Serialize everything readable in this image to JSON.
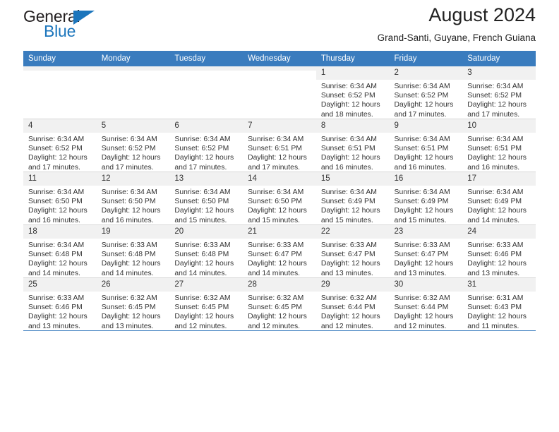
{
  "brand": {
    "name_part1": "General",
    "name_part2": "Blue",
    "triangle_color": "#1b75bc"
  },
  "header": {
    "title": "August 2024",
    "subtitle": "Grand-Santi, Guyane, French Guiana",
    "header_bg": "#3a7cbe"
  },
  "weekday_headers": [
    "Sunday",
    "Monday",
    "Tuesday",
    "Wednesday",
    "Thursday",
    "Friday",
    "Saturday"
  ],
  "weeks": [
    [
      {
        "day": "",
        "empty": true
      },
      {
        "day": "",
        "empty": true
      },
      {
        "day": "",
        "empty": true
      },
      {
        "day": "",
        "empty": true
      },
      {
        "day": "1",
        "sunrise": "Sunrise: 6:34 AM",
        "sunset": "Sunset: 6:52 PM",
        "daylight1": "Daylight: 12 hours",
        "daylight2": "and 18 minutes."
      },
      {
        "day": "2",
        "sunrise": "Sunrise: 6:34 AM",
        "sunset": "Sunset: 6:52 PM",
        "daylight1": "Daylight: 12 hours",
        "daylight2": "and 17 minutes."
      },
      {
        "day": "3",
        "sunrise": "Sunrise: 6:34 AM",
        "sunset": "Sunset: 6:52 PM",
        "daylight1": "Daylight: 12 hours",
        "daylight2": "and 17 minutes."
      }
    ],
    [
      {
        "day": "4",
        "sunrise": "Sunrise: 6:34 AM",
        "sunset": "Sunset: 6:52 PM",
        "daylight1": "Daylight: 12 hours",
        "daylight2": "and 17 minutes."
      },
      {
        "day": "5",
        "sunrise": "Sunrise: 6:34 AM",
        "sunset": "Sunset: 6:52 PM",
        "daylight1": "Daylight: 12 hours",
        "daylight2": "and 17 minutes."
      },
      {
        "day": "6",
        "sunrise": "Sunrise: 6:34 AM",
        "sunset": "Sunset: 6:52 PM",
        "daylight1": "Daylight: 12 hours",
        "daylight2": "and 17 minutes."
      },
      {
        "day": "7",
        "sunrise": "Sunrise: 6:34 AM",
        "sunset": "Sunset: 6:51 PM",
        "daylight1": "Daylight: 12 hours",
        "daylight2": "and 17 minutes."
      },
      {
        "day": "8",
        "sunrise": "Sunrise: 6:34 AM",
        "sunset": "Sunset: 6:51 PM",
        "daylight1": "Daylight: 12 hours",
        "daylight2": "and 16 minutes."
      },
      {
        "day": "9",
        "sunrise": "Sunrise: 6:34 AM",
        "sunset": "Sunset: 6:51 PM",
        "daylight1": "Daylight: 12 hours",
        "daylight2": "and 16 minutes."
      },
      {
        "day": "10",
        "sunrise": "Sunrise: 6:34 AM",
        "sunset": "Sunset: 6:51 PM",
        "daylight1": "Daylight: 12 hours",
        "daylight2": "and 16 minutes."
      }
    ],
    [
      {
        "day": "11",
        "sunrise": "Sunrise: 6:34 AM",
        "sunset": "Sunset: 6:50 PM",
        "daylight1": "Daylight: 12 hours",
        "daylight2": "and 16 minutes."
      },
      {
        "day": "12",
        "sunrise": "Sunrise: 6:34 AM",
        "sunset": "Sunset: 6:50 PM",
        "daylight1": "Daylight: 12 hours",
        "daylight2": "and 16 minutes."
      },
      {
        "day": "13",
        "sunrise": "Sunrise: 6:34 AM",
        "sunset": "Sunset: 6:50 PM",
        "daylight1": "Daylight: 12 hours",
        "daylight2": "and 15 minutes."
      },
      {
        "day": "14",
        "sunrise": "Sunrise: 6:34 AM",
        "sunset": "Sunset: 6:50 PM",
        "daylight1": "Daylight: 12 hours",
        "daylight2": "and 15 minutes."
      },
      {
        "day": "15",
        "sunrise": "Sunrise: 6:34 AM",
        "sunset": "Sunset: 6:49 PM",
        "daylight1": "Daylight: 12 hours",
        "daylight2": "and 15 minutes."
      },
      {
        "day": "16",
        "sunrise": "Sunrise: 6:34 AM",
        "sunset": "Sunset: 6:49 PM",
        "daylight1": "Daylight: 12 hours",
        "daylight2": "and 15 minutes."
      },
      {
        "day": "17",
        "sunrise": "Sunrise: 6:34 AM",
        "sunset": "Sunset: 6:49 PM",
        "daylight1": "Daylight: 12 hours",
        "daylight2": "and 14 minutes."
      }
    ],
    [
      {
        "day": "18",
        "sunrise": "Sunrise: 6:34 AM",
        "sunset": "Sunset: 6:48 PM",
        "daylight1": "Daylight: 12 hours",
        "daylight2": "and 14 minutes."
      },
      {
        "day": "19",
        "sunrise": "Sunrise: 6:33 AM",
        "sunset": "Sunset: 6:48 PM",
        "daylight1": "Daylight: 12 hours",
        "daylight2": "and 14 minutes."
      },
      {
        "day": "20",
        "sunrise": "Sunrise: 6:33 AM",
        "sunset": "Sunset: 6:48 PM",
        "daylight1": "Daylight: 12 hours",
        "daylight2": "and 14 minutes."
      },
      {
        "day": "21",
        "sunrise": "Sunrise: 6:33 AM",
        "sunset": "Sunset: 6:47 PM",
        "daylight1": "Daylight: 12 hours",
        "daylight2": "and 14 minutes."
      },
      {
        "day": "22",
        "sunrise": "Sunrise: 6:33 AM",
        "sunset": "Sunset: 6:47 PM",
        "daylight1": "Daylight: 12 hours",
        "daylight2": "and 13 minutes."
      },
      {
        "day": "23",
        "sunrise": "Sunrise: 6:33 AM",
        "sunset": "Sunset: 6:47 PM",
        "daylight1": "Daylight: 12 hours",
        "daylight2": "and 13 minutes."
      },
      {
        "day": "24",
        "sunrise": "Sunrise: 6:33 AM",
        "sunset": "Sunset: 6:46 PM",
        "daylight1": "Daylight: 12 hours",
        "daylight2": "and 13 minutes."
      }
    ],
    [
      {
        "day": "25",
        "sunrise": "Sunrise: 6:33 AM",
        "sunset": "Sunset: 6:46 PM",
        "daylight1": "Daylight: 12 hours",
        "daylight2": "and 13 minutes."
      },
      {
        "day": "26",
        "sunrise": "Sunrise: 6:32 AM",
        "sunset": "Sunset: 6:45 PM",
        "daylight1": "Daylight: 12 hours",
        "daylight2": "and 13 minutes."
      },
      {
        "day": "27",
        "sunrise": "Sunrise: 6:32 AM",
        "sunset": "Sunset: 6:45 PM",
        "daylight1": "Daylight: 12 hours",
        "daylight2": "and 12 minutes."
      },
      {
        "day": "28",
        "sunrise": "Sunrise: 6:32 AM",
        "sunset": "Sunset: 6:45 PM",
        "daylight1": "Daylight: 12 hours",
        "daylight2": "and 12 minutes."
      },
      {
        "day": "29",
        "sunrise": "Sunrise: 6:32 AM",
        "sunset": "Sunset: 6:44 PM",
        "daylight1": "Daylight: 12 hours",
        "daylight2": "and 12 minutes."
      },
      {
        "day": "30",
        "sunrise": "Sunrise: 6:32 AM",
        "sunset": "Sunset: 6:44 PM",
        "daylight1": "Daylight: 12 hours",
        "daylight2": "and 12 minutes."
      },
      {
        "day": "31",
        "sunrise": "Sunrise: 6:31 AM",
        "sunset": "Sunset: 6:43 PM",
        "daylight1": "Daylight: 12 hours",
        "daylight2": "and 11 minutes."
      }
    ]
  ]
}
